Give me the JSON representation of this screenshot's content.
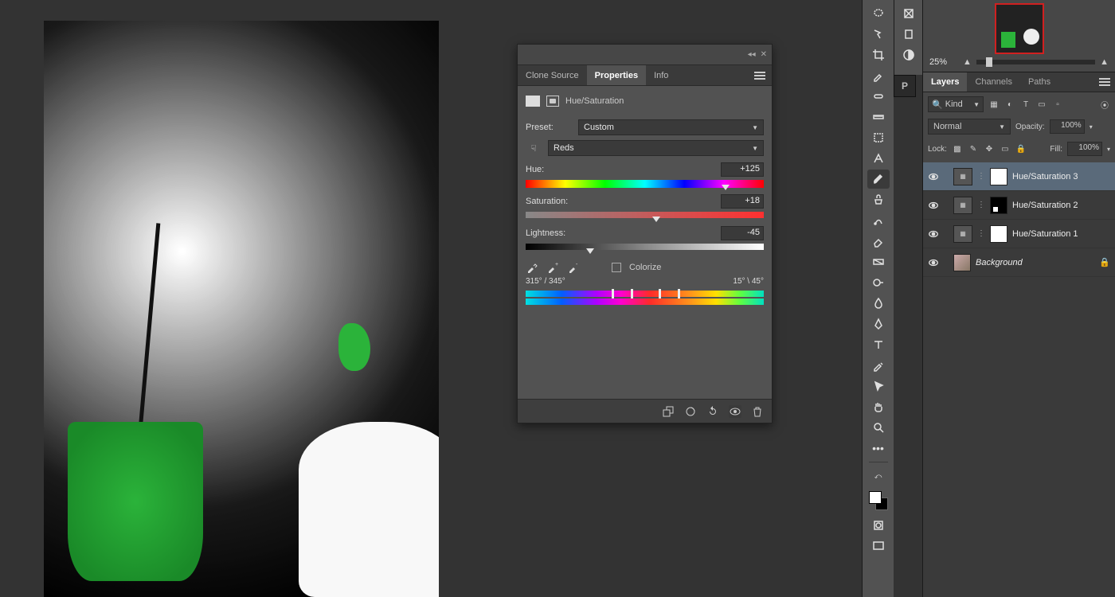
{
  "navigator": {
    "zoom_label": "25%"
  },
  "tool_strip2_stub": "P",
  "properties_panel": {
    "collapse_glyph": "◂◂",
    "close_glyph": "✕",
    "tabs": {
      "clone_source": "Clone Source",
      "properties": "Properties",
      "info": "Info"
    },
    "adjustment_title": "Hue/Saturation",
    "preset_label": "Preset:",
    "preset_value": "Custom",
    "channel_value": "Reds",
    "hand_glyph": "☟",
    "sliders": {
      "hue": {
        "label": "Hue:",
        "value": "+125",
        "thumb_pct": 84
      },
      "sat": {
        "label": "Saturation:",
        "value": "+18",
        "thumb_pct": 55
      },
      "light": {
        "label": "Lightness:",
        "value": "-45",
        "thumb_pct": 27
      }
    },
    "colorize_label": "Colorize",
    "range": {
      "left": "315° / 345°",
      "right": "15° \\ 45°",
      "h1_pct": 36,
      "h2_pct": 44,
      "h3_pct": 56,
      "h4_pct": 64
    },
    "footer_icons": {
      "clip": "clip",
      "prev": "prev",
      "reset": "reset",
      "eye": "eye",
      "trash": "trash"
    }
  },
  "layers_panel": {
    "tabs": {
      "layers": "Layers",
      "channels": "Channels",
      "paths": "Paths"
    },
    "filter_prefix": "🔍",
    "filter_label": "Kind",
    "blend_mode": "Normal",
    "opacity_label": "Opacity:",
    "opacity_value": "100%",
    "lock_label": "Lock:",
    "fill_label": "Fill:",
    "fill_value": "100%",
    "layers": [
      {
        "name": "Hue/Saturation 3",
        "mask": "white",
        "selected": true
      },
      {
        "name": "Hue/Saturation 2",
        "mask": "dark",
        "selected": false
      },
      {
        "name": "Hue/Saturation 1",
        "mask": "white",
        "selected": false
      }
    ],
    "background_layer": {
      "name": "Background"
    }
  }
}
